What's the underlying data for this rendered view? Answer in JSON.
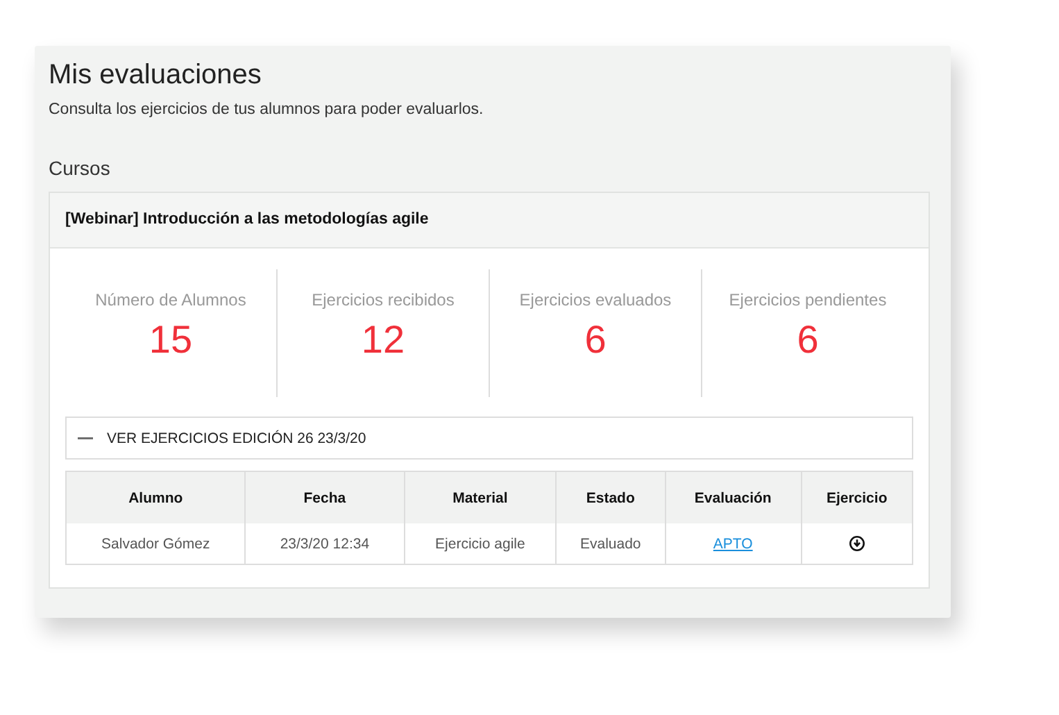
{
  "page": {
    "title": "Mis evaluaciones",
    "subtitle": "Consulta los ejercicios de tus alumnos para poder evaluarlos.",
    "section": "Cursos"
  },
  "course": {
    "title": "[Webinar] Introducción a las metodologías agile",
    "stats": [
      {
        "label": "Número de Alumnos",
        "value": "15"
      },
      {
        "label": "Ejercicios recibidos",
        "value": "12"
      },
      {
        "label": "Ejercicios evaluados",
        "value": "6"
      },
      {
        "label": "Ejercicios pendientes",
        "value": "6"
      }
    ],
    "edition": {
      "label": "VER EJERCICIOS EDICIÓN 26 23/3/20",
      "expanded": true
    },
    "table": {
      "columns": [
        "Alumno",
        "Fecha",
        "Material",
        "Estado",
        "Evaluación",
        "Ejercicio"
      ],
      "rows": [
        {
          "cells": [
            {
              "kind": "text",
              "text": "Salvador Gómez"
            },
            {
              "kind": "text",
              "text": "23/3/20 12:34"
            },
            {
              "kind": "text",
              "text": "Ejercicio agile"
            },
            {
              "kind": "text",
              "text": "Evaluado"
            },
            {
              "kind": "link",
              "text": "APTO"
            },
            {
              "kind": "download"
            }
          ]
        }
      ]
    }
  }
}
